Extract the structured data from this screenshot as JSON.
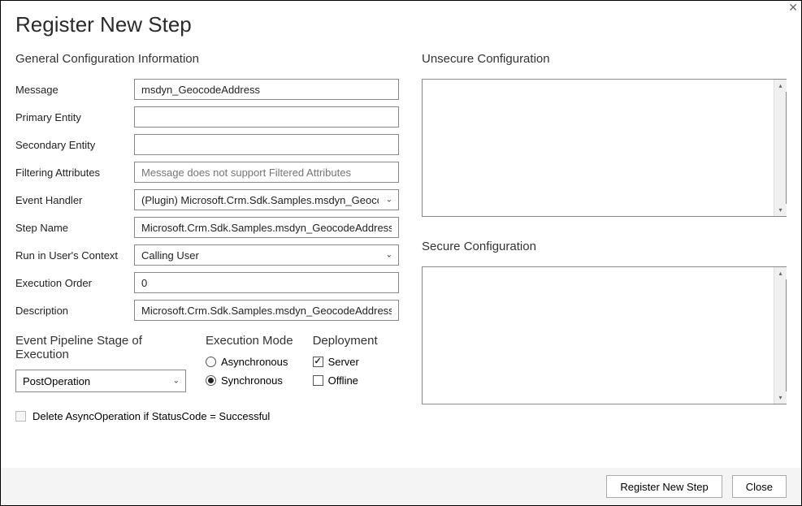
{
  "window": {
    "title": "Register New Step"
  },
  "general": {
    "section_title": "General Configuration Information",
    "labels": {
      "message": "Message",
      "primary_entity": "Primary Entity",
      "secondary_entity": "Secondary Entity",
      "filtering_attributes": "Filtering Attributes",
      "event_handler": "Event Handler",
      "step_name": "Step Name",
      "run_context": "Run in User's Context",
      "execution_order": "Execution Order",
      "description": "Description"
    },
    "values": {
      "message": "msdyn_GeocodeAddress",
      "primary_entity": "",
      "secondary_entity": "",
      "filtering_attributes_placeholder": "Message does not support Filtered Attributes",
      "event_handler": "(Plugin) Microsoft.Crm.Sdk.Samples.msdyn_GeocodeAddress",
      "step_name": "Microsoft.Crm.Sdk.Samples.msdyn_GeocodeAddress: msdyn_GeocodeAddress",
      "run_context": "Calling User",
      "execution_order": "0",
      "description": "Microsoft.Crm.Sdk.Samples.msdyn_GeocodeAddress: msdyn_GeocodeAddress"
    }
  },
  "pipeline": {
    "section_title": "Event Pipeline Stage of Execution",
    "selected": "PostOperation"
  },
  "execution_mode": {
    "section_title": "Execution Mode",
    "options": {
      "async": "Asynchronous",
      "sync": "Synchronous"
    },
    "selected": "sync"
  },
  "deployment": {
    "section_title": "Deployment",
    "options": {
      "server": {
        "label": "Server",
        "checked": true
      },
      "offline": {
        "label": "Offline",
        "checked": false
      }
    }
  },
  "delete_async": {
    "label": "Delete AsyncOperation if StatusCode = Successful",
    "checked": false,
    "enabled": false
  },
  "unsecure": {
    "section_title": "Unsecure  Configuration",
    "value": ""
  },
  "secure": {
    "section_title": "Secure  Configuration",
    "value": ""
  },
  "footer": {
    "register_button": "Register New Step",
    "close_button": "Close"
  }
}
